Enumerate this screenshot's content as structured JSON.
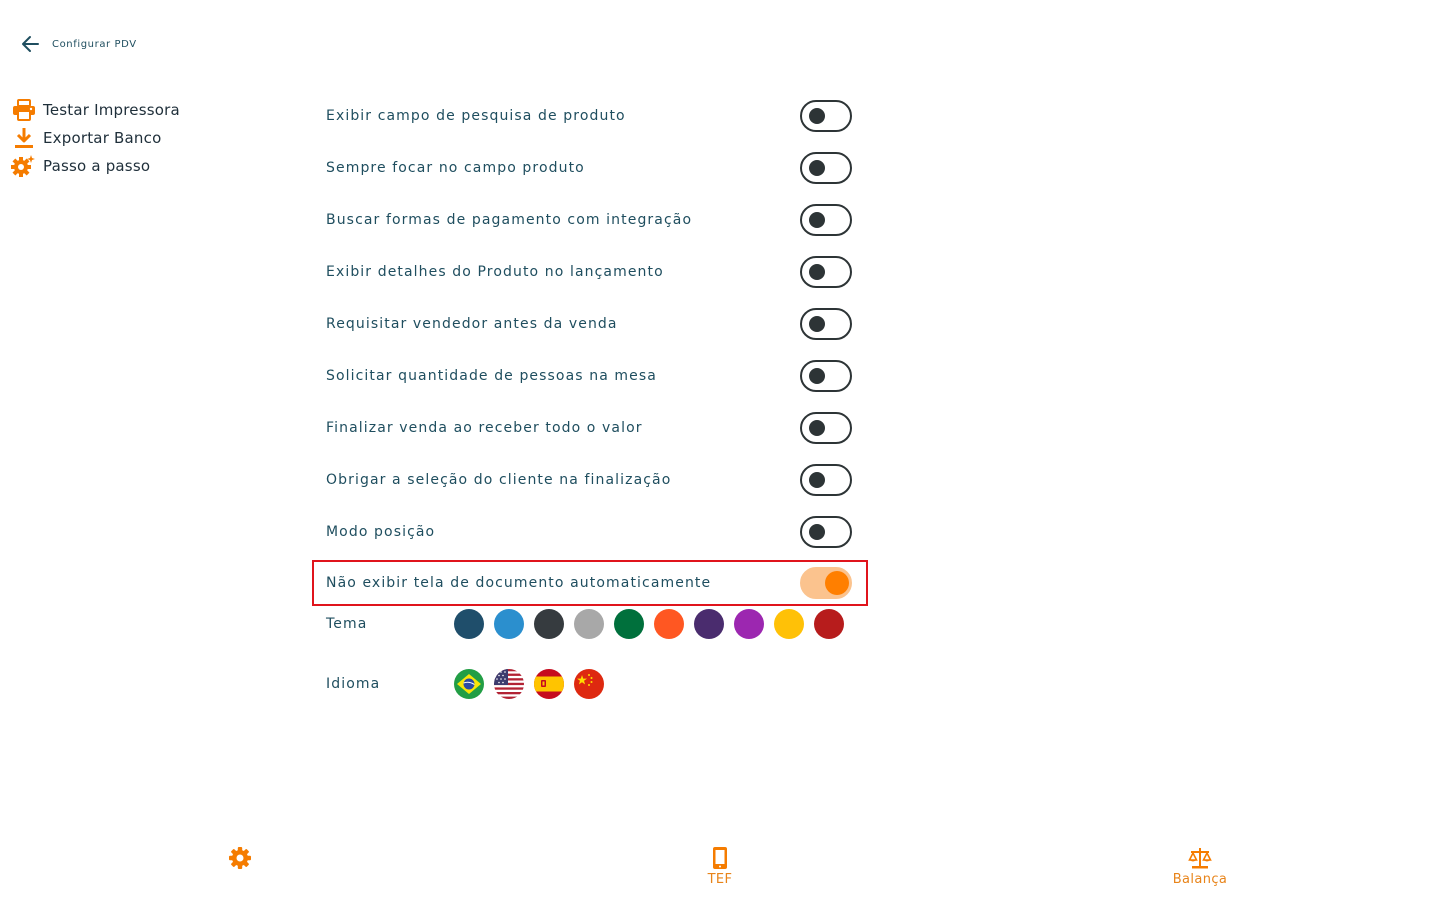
{
  "header": {
    "title": "Configurar PDV",
    "back_icon": "arrow-left-icon"
  },
  "sidebar": {
    "accent": "#f57c00",
    "items": [
      {
        "label": "Testar Impressora",
        "icon": "printer-icon"
      },
      {
        "label": "Exportar Banco",
        "icon": "download-icon"
      },
      {
        "label": "Passo a passo",
        "icon": "gear-sparkle-icon"
      }
    ]
  },
  "settings": [
    {
      "label": "Exibir campo de pesquisa de produto",
      "enabled": false
    },
    {
      "label": "Sempre focar no campo produto",
      "enabled": false
    },
    {
      "label": "Buscar formas de pagamento com integração",
      "enabled": false
    },
    {
      "label": "Exibir detalhes do Produto no lançamento",
      "enabled": false
    },
    {
      "label": "Requisitar vendedor antes da venda",
      "enabled": false
    },
    {
      "label": "Solicitar quantidade de pessoas na mesa",
      "enabled": false
    },
    {
      "label": "Finalizar venda ao receber todo o valor",
      "enabled": false
    },
    {
      "label": "Obrigar a seleção do cliente na finalização",
      "enabled": false
    },
    {
      "label": "Modo posição",
      "enabled": false
    },
    {
      "label": "Não exibir tela de documento automaticamente",
      "enabled": true,
      "highlighted": true
    }
  ],
  "theme": {
    "label": "Tema",
    "colors": [
      "#1f4e6b",
      "#2b8fce",
      "#363b3f",
      "#a8a8a8",
      "#00703c",
      "#ff5722",
      "#4a2c6e",
      "#9c27b0",
      "#ffc107",
      "#b71c1c"
    ]
  },
  "language": {
    "label": "Idioma",
    "flags": [
      "brazil-flag-icon",
      "usa-flag-icon",
      "spain-flag-icon",
      "china-flag-icon"
    ]
  },
  "bottom_nav": {
    "items": [
      {
        "label": "",
        "icon": "gear-icon"
      },
      {
        "label": "TEF",
        "icon": "mobile-icon"
      },
      {
        "label": "Balança",
        "icon": "scale-icon"
      }
    ]
  }
}
